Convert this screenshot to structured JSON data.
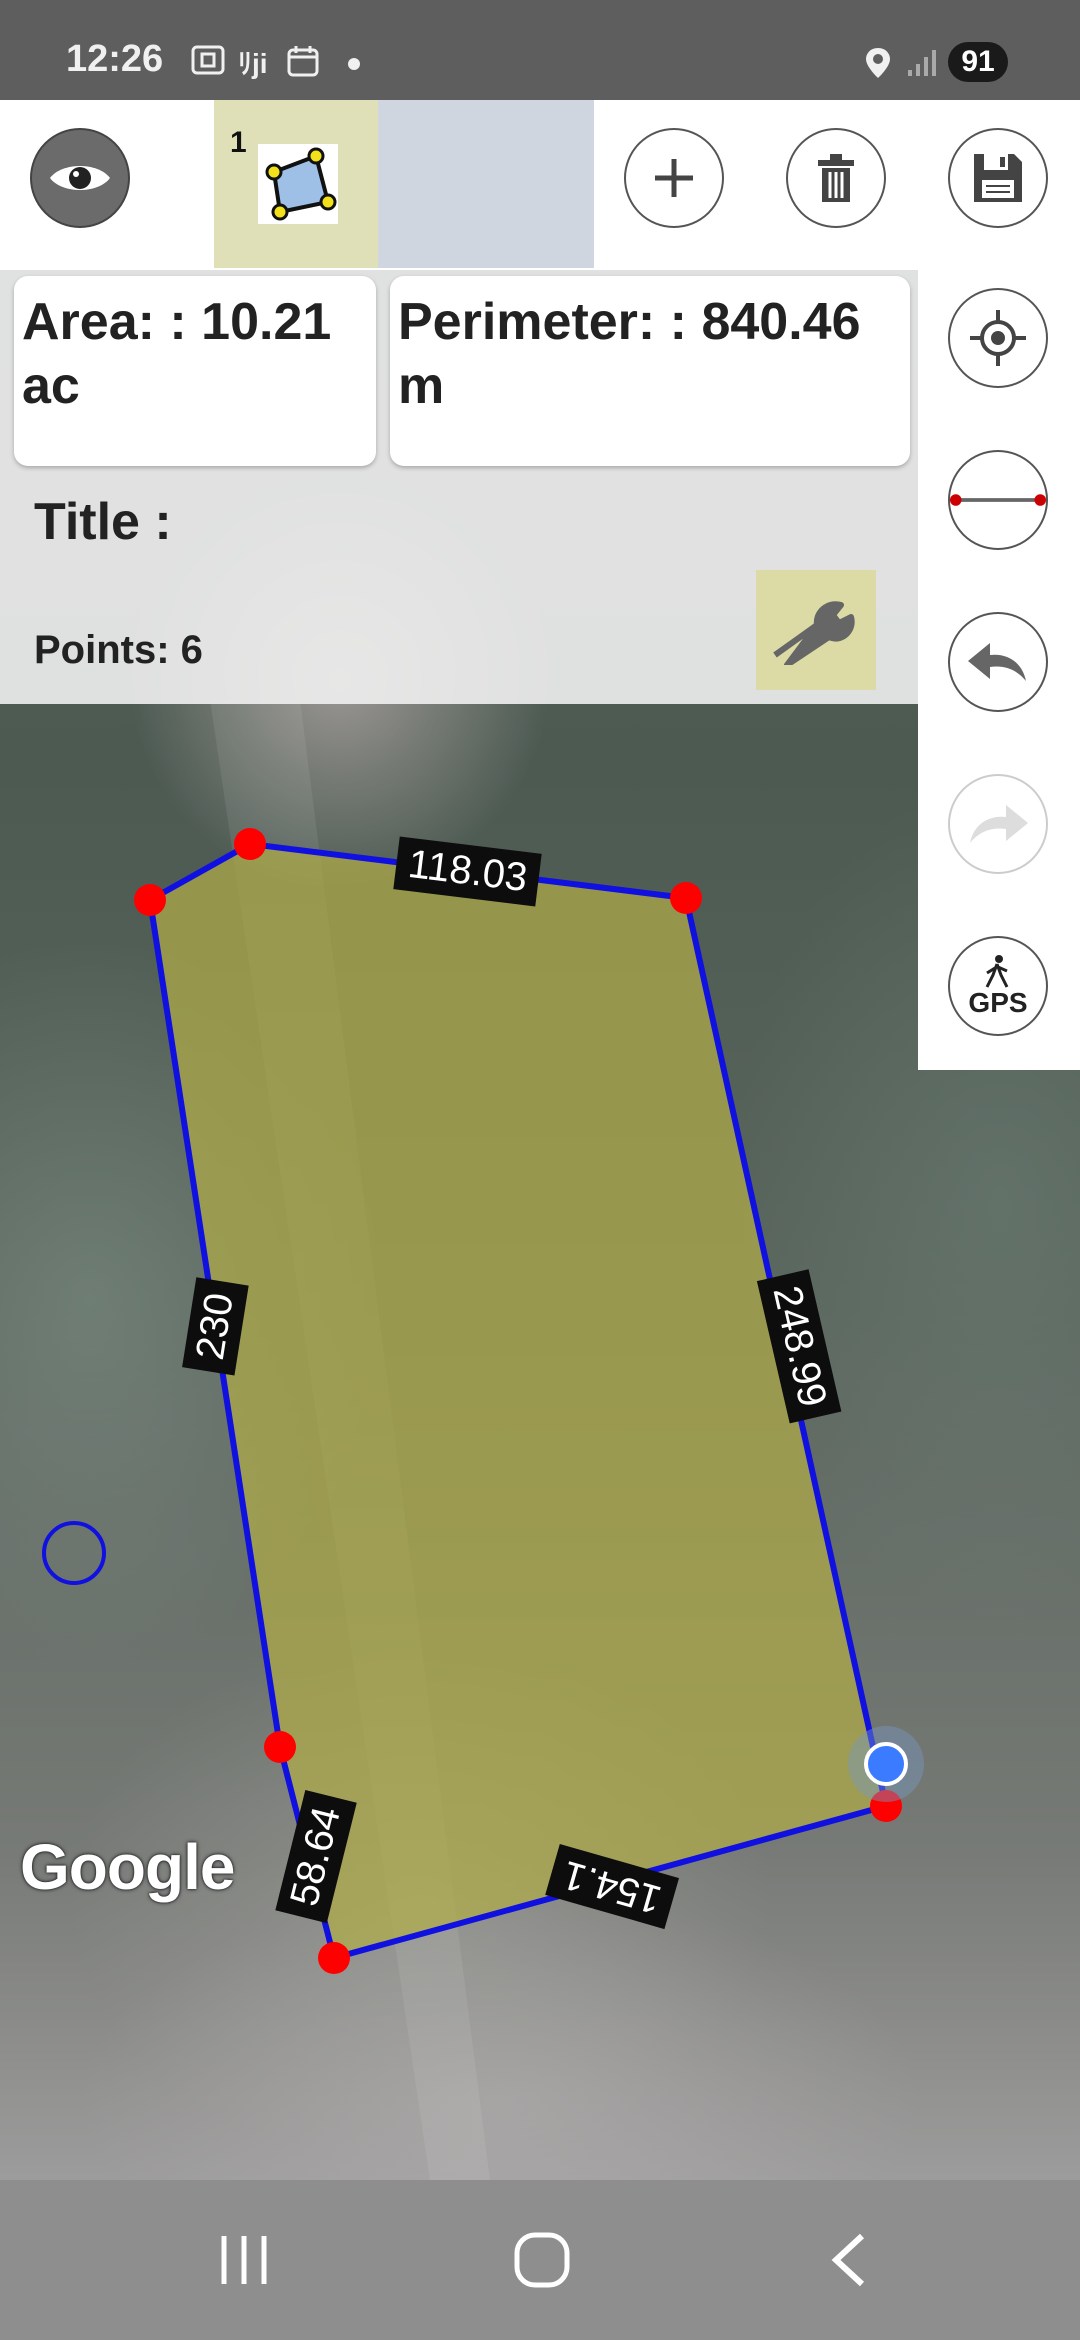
{
  "status_bar": {
    "time": "12:26",
    "icons": [
      "screenshot-icon",
      "jiji-icon",
      "calendar-icon",
      "dot-icon",
      "location-icon",
      "signal-icon"
    ],
    "battery": "91"
  },
  "toolbar": {
    "shape_number": "1",
    "buttons": [
      "visibility-eye",
      "add",
      "delete",
      "save"
    ]
  },
  "info": {
    "area": "Area: : 10.21 ac",
    "perimeter": "Perimeter: : 840.46 m",
    "title": "Title :",
    "points": "Points: 6"
  },
  "right_tools": [
    "my-location",
    "measure-line",
    "undo",
    "redo",
    "gps"
  ],
  "gps_label": "GPS",
  "measurements": {
    "top": "118.03",
    "right": "248.99",
    "left": "230",
    "bottom": "154.1",
    "bottom_left": "58.64"
  },
  "map": {
    "attribution": "Google",
    "polygon_fill": "#a6a44a",
    "polygon_stroke": "#1010e0",
    "vertex_color": "#ff0000"
  }
}
